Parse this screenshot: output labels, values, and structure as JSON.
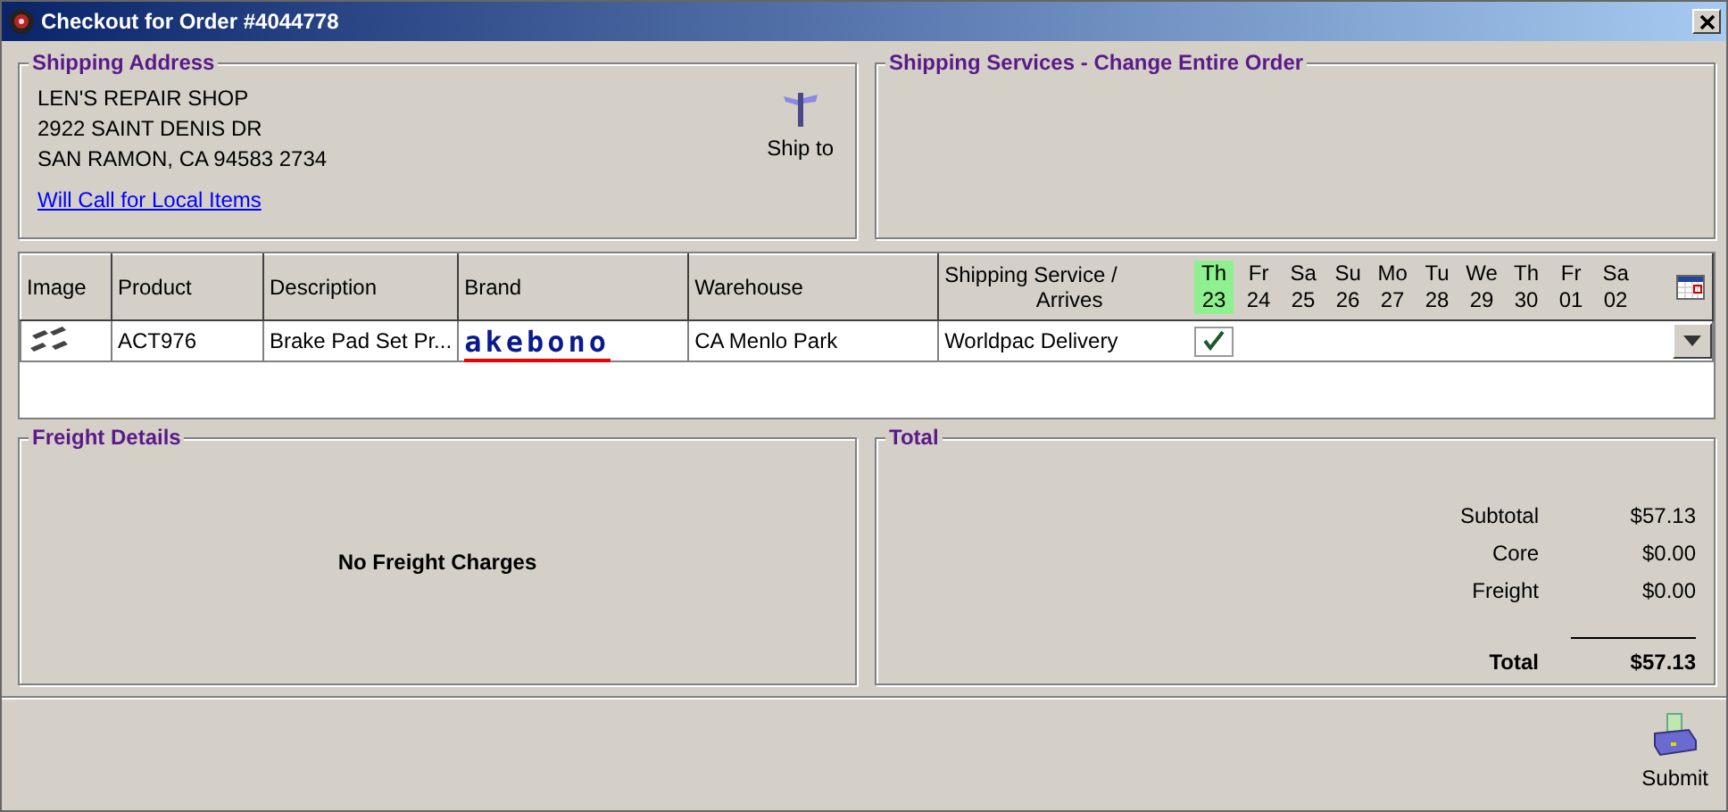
{
  "window": {
    "title": "Checkout for Order #4044778"
  },
  "shipping_address": {
    "title": "Shipping Address",
    "lines": [
      "LEN'S REPAIR SHOP",
      "2922 SAINT DENIS DR",
      "SAN RAMON, CA 94583 2734"
    ],
    "link": "Will Call for Local Items",
    "ship_to": "Ship to"
  },
  "shipping_services": {
    "title": "Shipping Services - Change Entire Order"
  },
  "table": {
    "columns": [
      "Image",
      "Product",
      "Description",
      "Brand",
      "Warehouse"
    ],
    "service_column": [
      "Shipping Service /",
      "Arrives"
    ],
    "days": [
      {
        "day": "Th",
        "date": "23",
        "selected": true
      },
      {
        "day": "Fr",
        "date": "24",
        "selected": false
      },
      {
        "day": "Sa",
        "date": "25",
        "selected": false
      },
      {
        "day": "Su",
        "date": "26",
        "selected": false
      },
      {
        "day": "Mo",
        "date": "27",
        "selected": false
      },
      {
        "day": "Tu",
        "date": "28",
        "selected": false
      },
      {
        "day": "We",
        "date": "29",
        "selected": false
      },
      {
        "day": "Th",
        "date": "30",
        "selected": false
      },
      {
        "day": "Fr",
        "date": "01",
        "selected": false
      },
      {
        "day": "Sa",
        "date": "02",
        "selected": false
      }
    ],
    "rows": [
      {
        "product": "ACT976",
        "description": "Brake Pad Set Pr...",
        "brand": "akebono",
        "warehouse": "CA Menlo Park",
        "service": "Worldpac Delivery",
        "checked": true
      }
    ]
  },
  "freight": {
    "title": "Freight Details",
    "message": "No Freight Charges"
  },
  "total": {
    "title": "Total",
    "lines": [
      {
        "label": "Subtotal",
        "value": "$57.13"
      },
      {
        "label": "Core",
        "value": "$0.00"
      },
      {
        "label": "Freight",
        "value": "$0.00"
      }
    ],
    "total": {
      "label": "Total",
      "value": "$57.13"
    }
  },
  "submit": "Submit"
}
